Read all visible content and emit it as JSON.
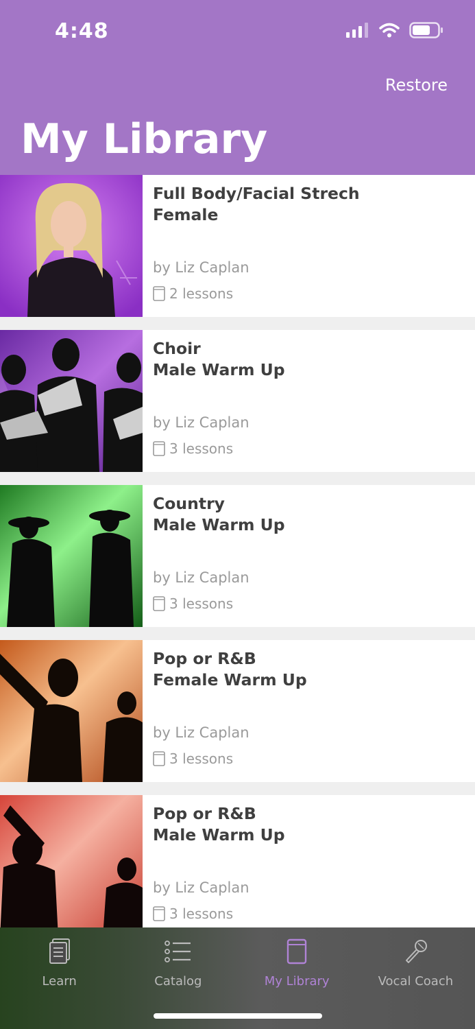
{
  "status_bar": {
    "time": "4:48"
  },
  "header": {
    "restore_label": "Restore",
    "title": "My Library"
  },
  "library": [
    {
      "line1": "Full Body/Facial Strech",
      "line2": "Female",
      "author": "by Liz Caplan",
      "lessons": "2 lessons"
    },
    {
      "line1": "Choir",
      "line2": "Male Warm Up",
      "author": "by Liz Caplan",
      "lessons": "3 lessons"
    },
    {
      "line1": "Country",
      "line2": "Male Warm Up",
      "author": "by Liz Caplan",
      "lessons": "3 lessons"
    },
    {
      "line1": "Pop or R&B",
      "line2": "Female Warm Up",
      "author": "by Liz Caplan",
      "lessons": "3 lessons"
    },
    {
      "line1": "Pop or R&B",
      "line2": "Male Warm Up",
      "author": "by Liz Caplan",
      "lessons": "3 lessons"
    }
  ],
  "tabs": [
    {
      "label": "Learn",
      "icon": "document-stack-icon"
    },
    {
      "label": "Catalog",
      "icon": "list-icon"
    },
    {
      "label": "My Library",
      "icon": "book-icon",
      "active": true
    },
    {
      "label": "Vocal Coach",
      "icon": "microphone-icon"
    }
  ],
  "colors": {
    "header": "#a376c6",
    "active_tab": "#b083d6",
    "text": "#3f3f3f",
    "muted": "#9a9a9a"
  }
}
